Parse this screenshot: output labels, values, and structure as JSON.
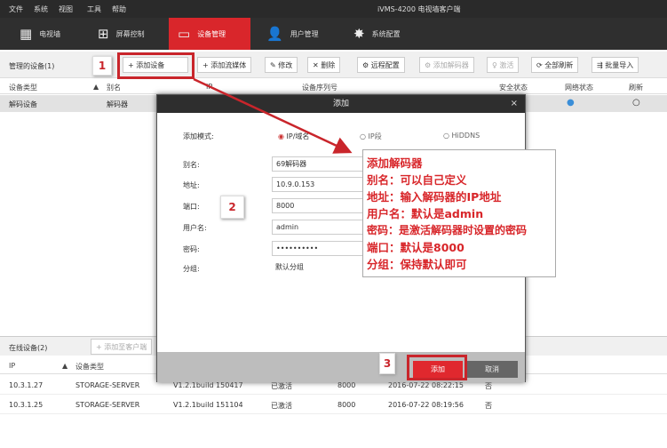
{
  "menu": [
    "文件",
    "系统",
    "视图",
    "工具",
    "帮助"
  ],
  "app_title": "iVMS-4200 电视墙客户端",
  "nav": [
    {
      "label": "电视墙",
      "icon": "tv-wall-icon"
    },
    {
      "label": "屏幕控制",
      "icon": "screen-control-icon"
    },
    {
      "label": "设备管理",
      "icon": "device-management-icon"
    },
    {
      "label": "用户管理",
      "icon": "user-icon"
    },
    {
      "label": "系统配置",
      "icon": "gear-icon"
    }
  ],
  "toolbar": {
    "managed": "管理的设备(1)",
    "buttons": [
      "+ 添加设备",
      "+ 添加流媒体",
      "✎ 修改",
      "✕ 删除",
      "⚙ 远程配置",
      "⚙ 添加解码器",
      "♀ 激活",
      "⟳ 全部刷新",
      "⇶ 批量导入"
    ]
  },
  "device_table": {
    "headers": [
      "设备类型",
      "别名",
      "IP",
      "设备序列号",
      "安全状态",
      "网络状态",
      "刷新"
    ],
    "rows": [
      [
        "解码设备",
        "解码器"
      ]
    ]
  },
  "dialog": {
    "title": "添加",
    "close": "×",
    "mode_label": "添加模式:",
    "modes": [
      "IP/域名",
      "IP段",
      "HiDDNS"
    ],
    "fields": [
      {
        "label": "别名:",
        "value": "69解码器"
      },
      {
        "label": "地址:",
        "value": "10.9.0.153"
      },
      {
        "label": "端口:",
        "value": "8000"
      },
      {
        "label": "用户名:",
        "value": "admin"
      },
      {
        "label": "密码:",
        "value": "••••••••••"
      },
      {
        "label": "分组:",
        "value": "默认分组"
      }
    ],
    "add": "添加",
    "cancel": "取消"
  },
  "annotation": [
    "添加解码器",
    "别名：可以自己定义",
    "地址：输入解码器的IP地址",
    "用户名：默认是admin",
    "密码：是激活解码器时设置的密码",
    "端口：默认是8000",
    "分组：保持默认即可"
  ],
  "steps": [
    "1",
    "2",
    "3"
  ],
  "online": {
    "title": "在线设备(2)",
    "add_btn": "+ 添加至客户端",
    "headers": [
      "IP",
      "设备类型"
    ],
    "rows": [
      [
        "10.3.1.27",
        "STORAGE-SERVER",
        "V1.2.1build 150417",
        "已激活",
        "8000",
        "2016-07-22 08:22:15",
        "否"
      ],
      [
        "10.3.1.25",
        "STORAGE-SERVER",
        "V1.2.1build 151104",
        "已激活",
        "8000",
        "2016-07-22 08:19:56",
        "否"
      ]
    ]
  }
}
